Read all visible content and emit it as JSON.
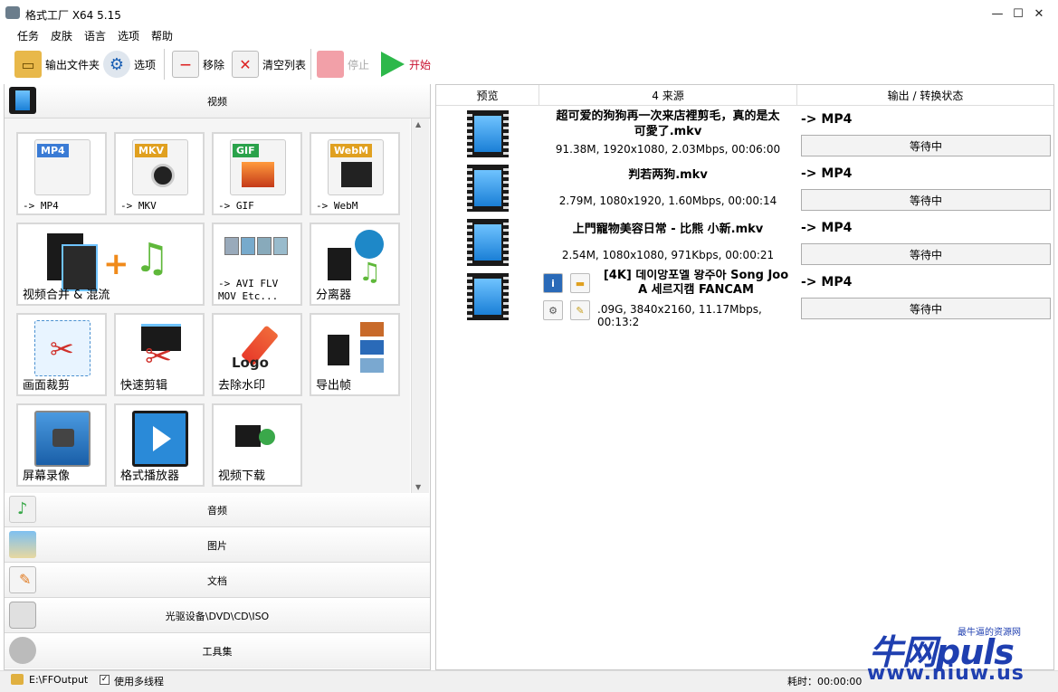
{
  "window": {
    "title": "格式工厂 X64 5.15",
    "minimize": "—",
    "maximize": "☐",
    "close": "✕"
  },
  "menu": [
    "任务",
    "皮肤",
    "语言",
    "选项",
    "帮助"
  ],
  "toolbar": {
    "output_folder": "输出文件夹",
    "options": "选项",
    "remove": "移除",
    "clear_list": "清空列表",
    "stop": "停止",
    "start": "开始"
  },
  "left": {
    "video_header": "视频",
    "tiles": [
      {
        "label": "-> MP4",
        "badge": "MP4",
        "color": "#3a7bd5"
      },
      {
        "label": "-> MKV",
        "badge": "MKV",
        "color": "#e0a020"
      },
      {
        "label": "-> GIF",
        "badge": "GIF",
        "color": "#2aa24a"
      },
      {
        "label": "-> WebM",
        "badge": "WebM",
        "color": "#e0a020"
      },
      {
        "label": "视频合并 & 混流"
      },
      {
        "label": "-> AVI FLV",
        "label2": "MOV Etc..."
      },
      {
        "label": "分离器"
      },
      {
        "label": "画面裁剪"
      },
      {
        "label": "快速剪辑"
      },
      {
        "label": "去除水印",
        "logo_text": "Logo"
      },
      {
        "label": "导出帧"
      },
      {
        "label": "屏幕录像"
      },
      {
        "label": "格式播放器"
      },
      {
        "label": "视频下载"
      }
    ],
    "categories": [
      "音频",
      "图片",
      "文档",
      "光驱设备\\DVD\\CD\\ISO",
      "工具集"
    ]
  },
  "right": {
    "columns": [
      "预览",
      "4 来源",
      "输出 / 转换状态"
    ],
    "files": [
      {
        "name1": "超可爱的狗狗再一次来店裡剪毛，真的是太",
        "name2": "可愛了.mkv",
        "info": "91.38M, 1920x1080, 2.03Mbps, 00:06:00",
        "format": "-> MP4",
        "status": "等待中"
      },
      {
        "name1": "判若两狗.mkv",
        "name2": "",
        "info": "2.79M, 1080x1920, 1.60Mbps, 00:00:14",
        "format": "-> MP4",
        "status": "等待中"
      },
      {
        "name1": "上門寵物美容日常 - 比熊 小新.mkv",
        "name2": "",
        "info": "2.54M, 1080x1080, 971Kbps, 00:00:21",
        "format": "-> MP4",
        "status": "等待中"
      },
      {
        "name1": "[4K] 데이앙포엘 왕주아 Song Joo",
        "name2": "A 세르지캠 FANCAM",
        "info": ".09G, 3840x2160, 11.17Mbps, 00:13:2",
        "format": "-> MP4",
        "status": "等待中"
      }
    ]
  },
  "statusbar": {
    "output_path": "E:\\FFOutput",
    "multithread": "使用多线程",
    "elapsed": "耗时：00:00:00"
  },
  "watermark": {
    "brand": "牛网puls",
    "tag": "最牛逼的资源网",
    "url": "www.niuw.us"
  },
  "colors": {
    "start_green": "#2db84a",
    "stop_pink": "#f2a0a8",
    "accent_blue": "#1f3fb0"
  }
}
